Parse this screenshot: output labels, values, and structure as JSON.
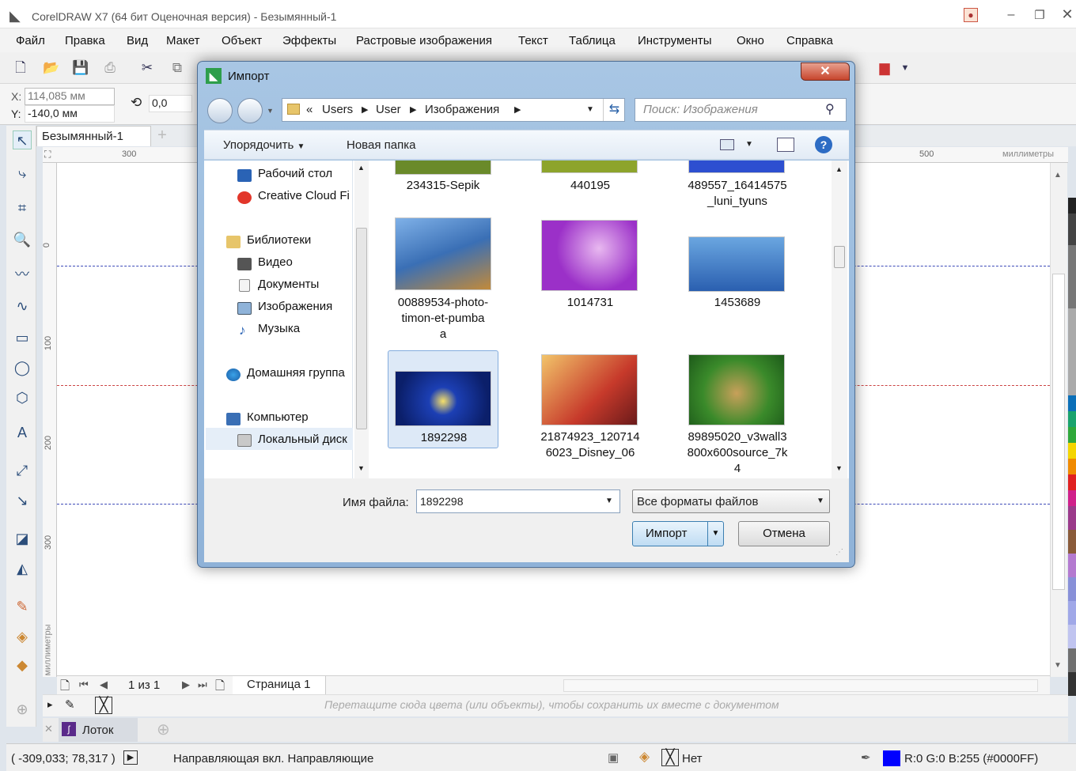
{
  "app": {
    "title": "CorelDRAW X7 (64 бит Оценочная версия) - Безымянный-1"
  },
  "menu": [
    "Файл",
    "Правка",
    "Вид",
    "Макет",
    "Объект",
    "Эффекты",
    "Растровые изображения",
    "Текст",
    "Таблица",
    "Инструменты",
    "Окно",
    "Справка"
  ],
  "props": {
    "x_label": "X:",
    "x_value": "114,085 мм",
    "y_label": "Y:",
    "y_value": "-140,0 мм",
    "rotation": "0,0"
  },
  "doc_tab": "Безымянный-1",
  "ruler": {
    "h_ticks": [
      "300",
      "500"
    ],
    "unit": "миллиметры",
    "v_ticks": [
      "0",
      "100",
      "200",
      "300"
    ]
  },
  "pages": {
    "counter": "1 из 1",
    "page_tab": "Страница 1"
  },
  "colorbar_hint": "Перетащите сюда цвета (или объекты), чтобы сохранить их вместе с документом",
  "tray": {
    "label": "Лоток"
  },
  "status": {
    "coords": "( -309,033; 78,317 )",
    "message": "Направляющая вкл. Направляющие",
    "fill": "Нет",
    "color": "R:0 G:0 B:255 (#0000FF)",
    "color_hex": "#0000FF"
  },
  "dialog": {
    "title": "Импорт",
    "path": [
      "«",
      "Users",
      "User",
      "Изображения"
    ],
    "search_placeholder": "Поиск: Изображения",
    "organize": "Упорядочить",
    "new_folder": "Новая папка",
    "nav": [
      {
        "label": "Рабочий стол",
        "icon": "desktop-icon"
      },
      {
        "label": "Creative Cloud Fi",
        "icon": "creative-cloud-icon"
      },
      {
        "label": "Библиотеки",
        "icon": "libraries-icon"
      },
      {
        "label": "Видео",
        "icon": "video-icon"
      },
      {
        "label": "Документы",
        "icon": "documents-icon"
      },
      {
        "label": "Изображения",
        "icon": "pictures-icon"
      },
      {
        "label": "Музыка",
        "icon": "music-icon"
      },
      {
        "label": "Домашняя группа",
        "icon": "homegroup-icon"
      },
      {
        "label": "Компьютер",
        "icon": "computer-icon"
      },
      {
        "label": "Локальный диск",
        "icon": "local-disk-icon"
      }
    ],
    "files": [
      {
        "name": "234315-Sepik",
        "color": "#6a8a2a"
      },
      {
        "name": "440195",
        "color": "#8da42c"
      },
      {
        "name": "489557_16414575\n_luni_tyuns",
        "color": "#2d4fd0"
      },
      {
        "name": "00889534-photo-\ntimon-et-pumba\na",
        "color": "#4d7fc8"
      },
      {
        "name": "1014731",
        "color": "#9b30c8"
      },
      {
        "name": "1453689",
        "color": "#4d8ed0"
      },
      {
        "name": "1892298",
        "color": "#1c3fb4"
      },
      {
        "name": "21874923_120714\n6023_Disney_06",
        "color": "#c73a2b"
      },
      {
        "name": "89895020_v3wall3\n800x600source_7k\n4",
        "color": "#3a8a2a"
      }
    ],
    "filename_label": "Имя файла:",
    "filename_value": "1892298",
    "filetype": "Все форматы файлов",
    "import_button": "Импорт",
    "cancel_button": "Отмена"
  }
}
